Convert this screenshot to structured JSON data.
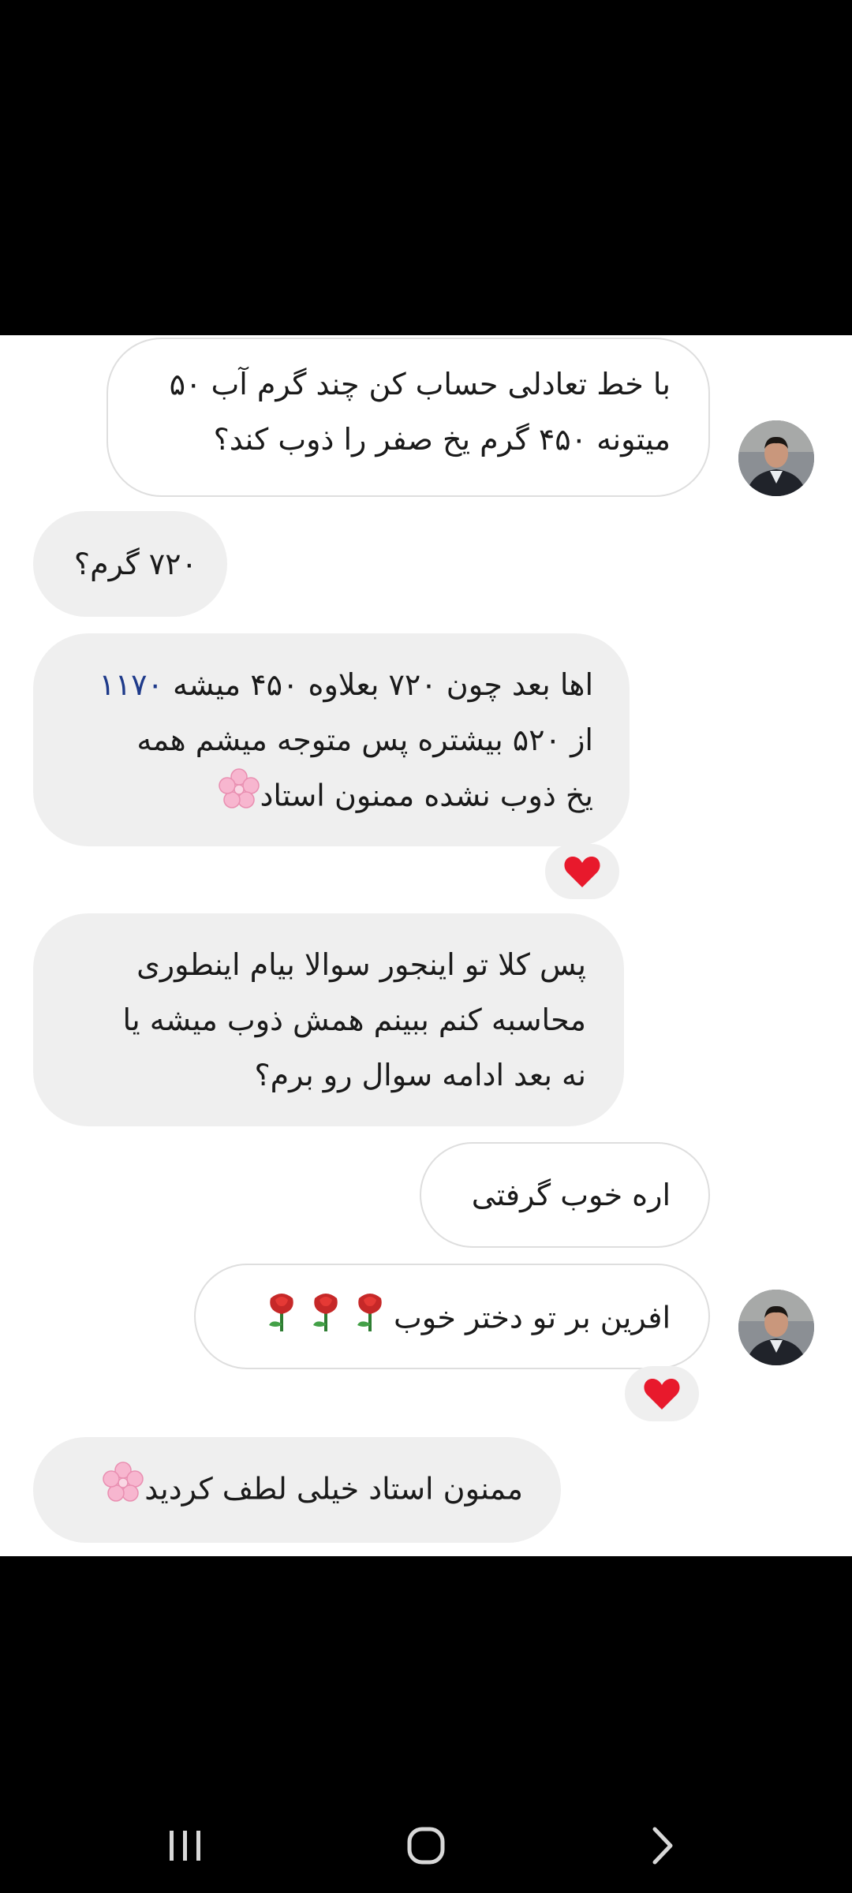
{
  "messages": [
    {
      "direction": "outgoing",
      "lines": [
        "با خط تعادلی حساب کن چند گرم آب ۵۰",
        "میتونه ۴۵۰ گرم یخ صفر را ذوب کند؟"
      ],
      "avatar": "teacher-avatar"
    },
    {
      "direction": "incoming",
      "lines": [
        "۷۲۰ گرم؟"
      ]
    },
    {
      "direction": "incoming",
      "line1_prefix": "اها بعد چون ۷۲۰ بعلاوه ۴۵۰ میشه ",
      "line1_number": "۱۱۷۰",
      "line2": "از ۵۲۰ بیشتره پس متوجه میشم همه",
      "line3": "یخ ذوب نشده ممنون استاد",
      "reaction": "heart-icon",
      "trailing_icon": "cherry-blossom-icon"
    },
    {
      "direction": "incoming",
      "lines": [
        "پس کلا تو اینجور سوالا بیام اینطوری",
        "محاسبه کنم ببینم همش ذوب میشه یا",
        "نه بعد ادامه سوال رو برم؟"
      ]
    },
    {
      "direction": "outgoing",
      "lines": [
        "اره خوب گرفتی"
      ]
    },
    {
      "direction": "outgoing",
      "text": "افرین بر تو دختر خوب",
      "trailing_icons": [
        "rose-icon",
        "rose-icon",
        "rose-icon"
      ],
      "avatar": "teacher-avatar",
      "reaction": "heart-icon"
    },
    {
      "direction": "incoming",
      "text": "ممنون استاد خیلی لطف کردید",
      "trailing_icon": "cherry-blossom-icon"
    }
  ],
  "colors": {
    "outgoing_bg": "#ffffff",
    "incoming_bg": "#efefef",
    "heart": "#e8192c",
    "link_number": "#1e3a8a"
  },
  "nav": {
    "recent_apps": "recent-apps-icon",
    "home": "home-icon",
    "back": "back-icon"
  }
}
